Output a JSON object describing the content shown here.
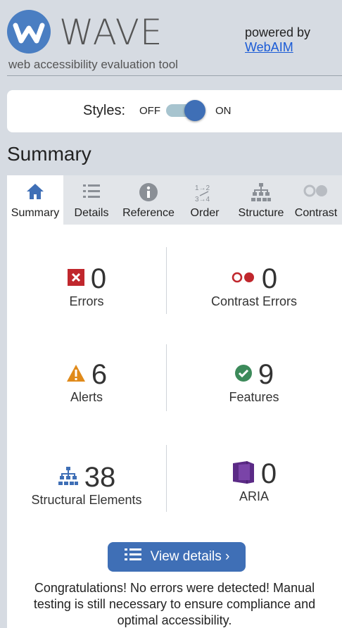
{
  "header": {
    "brand": "WAVE",
    "tagline": "web accessibility evaluation tool",
    "powered_by": "powered by",
    "webaim_link": "WebAIM"
  },
  "styles_toggle": {
    "label": "Styles:",
    "off": "OFF",
    "on": "ON",
    "state": "on"
  },
  "page_title": "Summary",
  "tabs": [
    {
      "label": "Summary",
      "icon": "home-icon",
      "active": true
    },
    {
      "label": "Details",
      "icon": "list-icon",
      "active": false
    },
    {
      "label": "Reference",
      "icon": "info-icon",
      "active": false
    },
    {
      "label": "Order",
      "icon": "order-icon",
      "active": false
    },
    {
      "label": "Structure",
      "icon": "structure-icon",
      "active": false
    },
    {
      "label": "Contrast",
      "icon": "contrast-icon",
      "active": false
    }
  ],
  "stats": {
    "errors": {
      "value": "0",
      "label": "Errors",
      "icon": "error-icon"
    },
    "contrast_errors": {
      "value": "0",
      "label": "Contrast Errors",
      "icon": "contrast-error-icon"
    },
    "alerts": {
      "value": "6",
      "label": "Alerts",
      "icon": "alert-icon"
    },
    "features": {
      "value": "9",
      "label": "Features",
      "icon": "feature-icon"
    },
    "structural": {
      "value": "38",
      "label": "Structural Elements",
      "icon": "structure-icon"
    },
    "aria": {
      "value": "0",
      "label": "ARIA",
      "icon": "aria-icon"
    }
  },
  "view_details_button": "View details ›",
  "congrats_message": "Congratulations! No errors were detected! Manual testing is still necessary to ensure compliance and optimal accessibility.",
  "colors": {
    "accent": "#3f6fb6",
    "error": "#c0272d",
    "alert": "#e08a1a",
    "feature": "#3c8a5a",
    "aria": "#5b2a86",
    "structure": "#3f6fb6"
  }
}
